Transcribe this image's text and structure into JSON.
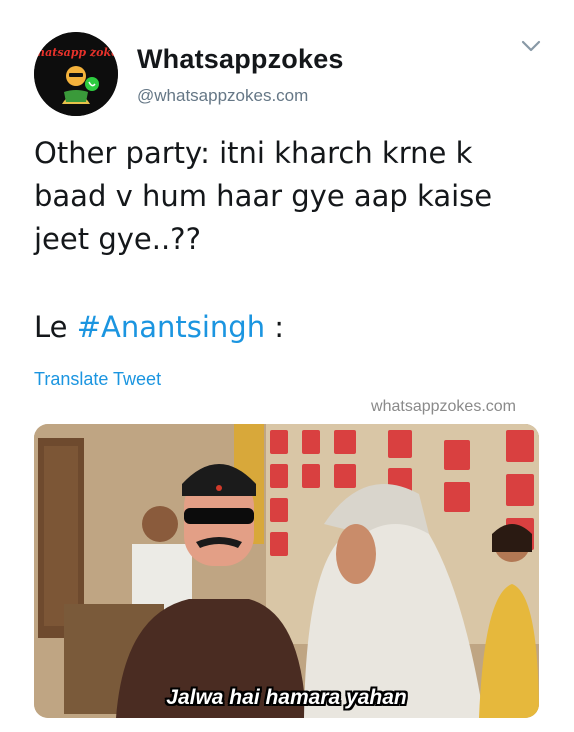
{
  "tweet": {
    "display_name": "Whatsappzokes",
    "handle": "@whatsappzokes.com",
    "text_lines": [
      "Other party: itni kharch krne k",
      "baad v hum haar gye aap kaise",
      "jeet gye..??"
    ],
    "line2_prefix": "Le ",
    "hashtag": "#Anantsingh",
    "line2_suffix": " :",
    "translate_label": "Translate Tweet",
    "watermark": "whatsappzokes.com",
    "avatar_text": "whatsapp zokes"
  },
  "media": {
    "subtitle": "Jalwa hai hamara yahan"
  },
  "colors": {
    "link": "#1b95e0",
    "secondary": "#657786",
    "text": "#14171a"
  },
  "icons": {
    "menu": "chevron-down-icon"
  }
}
